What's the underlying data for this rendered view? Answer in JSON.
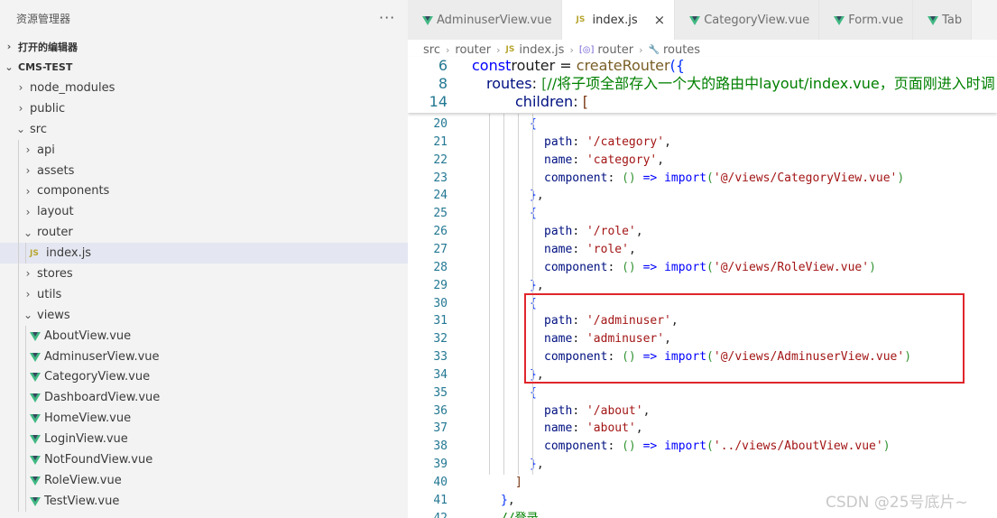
{
  "explorer": {
    "title": "资源管理器",
    "more": "···",
    "open_editors": "打开的编辑器",
    "project": "CMS-TEST",
    "tree": [
      {
        "label": "node_modules",
        "depth": 0,
        "chevron": "›"
      },
      {
        "label": "public",
        "depth": 0,
        "chevron": "›"
      },
      {
        "label": "src",
        "depth": 0,
        "chevron": "⌄"
      },
      {
        "label": "api",
        "depth": 1,
        "chevron": "›"
      },
      {
        "label": "assets",
        "depth": 1,
        "chevron": "›"
      },
      {
        "label": "components",
        "depth": 1,
        "chevron": "›"
      },
      {
        "label": "layout",
        "depth": 1,
        "chevron": "›"
      },
      {
        "label": "router",
        "depth": 1,
        "chevron": "⌄"
      },
      {
        "label": "index.js",
        "depth": 2,
        "icon": "js",
        "selected": true
      },
      {
        "label": "stores",
        "depth": 1,
        "chevron": "›"
      },
      {
        "label": "utils",
        "depth": 1,
        "chevron": "›"
      },
      {
        "label": "views",
        "depth": 1,
        "chevron": "⌄"
      },
      {
        "label": "AboutView.vue",
        "depth": 2,
        "icon": "vue"
      },
      {
        "label": "AdminuserView.vue",
        "depth": 2,
        "icon": "vue"
      },
      {
        "label": "CategoryView.vue",
        "depth": 2,
        "icon": "vue"
      },
      {
        "label": "DashboardView.vue",
        "depth": 2,
        "icon": "vue"
      },
      {
        "label": "HomeView.vue",
        "depth": 2,
        "icon": "vue"
      },
      {
        "label": "LoginView.vue",
        "depth": 2,
        "icon": "vue"
      },
      {
        "label": "NotFoundView.vue",
        "depth": 2,
        "icon": "vue"
      },
      {
        "label": "RoleView.vue",
        "depth": 2,
        "icon": "vue"
      },
      {
        "label": "TestView.vue",
        "depth": 2,
        "icon": "vue"
      }
    ]
  },
  "tabs": [
    {
      "label": "AdminuserView.vue",
      "icon": "vue",
      "active": false
    },
    {
      "label": "index.js",
      "icon": "js",
      "active": true,
      "close": "×"
    },
    {
      "label": "CategoryView.vue",
      "icon": "vue",
      "active": false
    },
    {
      "label": "Form.vue",
      "icon": "vue",
      "active": false
    },
    {
      "label": "Tab",
      "icon": "vue",
      "active": false
    }
  ],
  "breadcrumb": {
    "items": [
      "src",
      "router",
      "index.js",
      "router",
      "routes"
    ],
    "separator": "›"
  },
  "sticky_lines": [
    {
      "n": "6",
      "indent": 0,
      "tokens": [
        [
          "k",
          "const"
        ],
        [
          "",
          "router = "
        ],
        [
          "f",
          "createRouter"
        ],
        [
          "b1",
          "({"
        ]
      ]
    },
    {
      "n": "8",
      "indent": 1,
      "tokens": [
        [
          "p",
          "routes"
        ],
        [
          "",
          ": "
        ],
        [
          "b2",
          "["
        ],
        [
          "c",
          "//将子项全部存入一个大的路由中layout/index.vue，页面刚进入时调"
        ]
      ]
    },
    {
      "n": "14",
      "indent": 3,
      "tokens": [
        [
          "p",
          "children"
        ],
        [
          "",
          ": "
        ],
        [
          "b3",
          "["
        ]
      ]
    }
  ],
  "code_lines": [
    {
      "n": "20",
      "indent": 4,
      "tokens": [
        [
          "b1",
          "{"
        ]
      ]
    },
    {
      "n": "21",
      "indent": 5,
      "tokens": [
        [
          "p",
          "path"
        ],
        [
          "",
          ": "
        ],
        [
          "s",
          "'/category'"
        ],
        [
          "",
          ","
        ]
      ]
    },
    {
      "n": "22",
      "indent": 5,
      "tokens": [
        [
          "p",
          "name"
        ],
        [
          "",
          ": "
        ],
        [
          "s",
          "'category'"
        ],
        [
          "",
          ","
        ]
      ]
    },
    {
      "n": "23",
      "indent": 5,
      "tokens": [
        [
          "p",
          "component"
        ],
        [
          "",
          ": "
        ],
        [
          "b2",
          "()"
        ],
        [
          "k",
          " =>"
        ],
        [
          "",
          ""
        ],
        [
          "k",
          " import"
        ],
        [
          "b2",
          "("
        ],
        [
          "s",
          "'@/views/CategoryView.vue'"
        ],
        [
          "b2",
          ")"
        ]
      ]
    },
    {
      "n": "24",
      "indent": 4,
      "tokens": [
        [
          "b1",
          "}"
        ],
        [
          "",
          ","
        ]
      ]
    },
    {
      "n": "25",
      "indent": 4,
      "tokens": [
        [
          "b1",
          "{"
        ]
      ]
    },
    {
      "n": "26",
      "indent": 5,
      "tokens": [
        [
          "p",
          "path"
        ],
        [
          "",
          ": "
        ],
        [
          "s",
          "'/role'"
        ],
        [
          "",
          ","
        ]
      ]
    },
    {
      "n": "27",
      "indent": 5,
      "tokens": [
        [
          "p",
          "name"
        ],
        [
          "",
          ": "
        ],
        [
          "s",
          "'role'"
        ],
        [
          "",
          ","
        ]
      ]
    },
    {
      "n": "28",
      "indent": 5,
      "tokens": [
        [
          "p",
          "component"
        ],
        [
          "",
          ": "
        ],
        [
          "b2",
          "()"
        ],
        [
          "k",
          " =>"
        ],
        [
          "k",
          " import"
        ],
        [
          "b2",
          "("
        ],
        [
          "s",
          "'@/views/RoleView.vue'"
        ],
        [
          "b2",
          ")"
        ]
      ]
    },
    {
      "n": "29",
      "indent": 4,
      "tokens": [
        [
          "b1",
          "}"
        ],
        [
          "",
          ","
        ]
      ]
    },
    {
      "n": "30",
      "indent": 4,
      "tokens": [
        [
          "b1",
          "{"
        ]
      ]
    },
    {
      "n": "31",
      "indent": 5,
      "tokens": [
        [
          "p",
          "path"
        ],
        [
          "",
          ": "
        ],
        [
          "s",
          "'/adminuser'"
        ],
        [
          "",
          ","
        ]
      ]
    },
    {
      "n": "32",
      "indent": 5,
      "tokens": [
        [
          "p",
          "name"
        ],
        [
          "",
          ": "
        ],
        [
          "s",
          "'adminuser'"
        ],
        [
          "",
          ","
        ]
      ]
    },
    {
      "n": "33",
      "indent": 5,
      "tokens": [
        [
          "p",
          "component"
        ],
        [
          "",
          ": "
        ],
        [
          "b2",
          "()"
        ],
        [
          "k",
          " =>"
        ],
        [
          "k",
          " import"
        ],
        [
          "b2",
          "("
        ],
        [
          "s",
          "'@/views/AdminuserView.vue'"
        ],
        [
          "b2",
          ")"
        ]
      ]
    },
    {
      "n": "34",
      "indent": 4,
      "tokens": [
        [
          "b1",
          "}"
        ],
        [
          "",
          ","
        ]
      ]
    },
    {
      "n": "35",
      "indent": 4,
      "tokens": [
        [
          "b1",
          "{"
        ]
      ]
    },
    {
      "n": "36",
      "indent": 5,
      "tokens": [
        [
          "p",
          "path"
        ],
        [
          "",
          ": "
        ],
        [
          "s",
          "'/about'"
        ],
        [
          "",
          ","
        ]
      ]
    },
    {
      "n": "37",
      "indent": 5,
      "tokens": [
        [
          "p",
          "name"
        ],
        [
          "",
          ": "
        ],
        [
          "s",
          "'about'"
        ],
        [
          "",
          ","
        ]
      ]
    },
    {
      "n": "38",
      "indent": 5,
      "tokens": [
        [
          "p",
          "component"
        ],
        [
          "",
          ": "
        ],
        [
          "b2",
          "()"
        ],
        [
          "k",
          " =>"
        ],
        [
          "k",
          " import"
        ],
        [
          "b2",
          "("
        ],
        [
          "s",
          "'../views/AboutView.vue'"
        ],
        [
          "b2",
          ")"
        ]
      ]
    },
    {
      "n": "39",
      "indent": 4,
      "tokens": [
        [
          "b1",
          "}"
        ],
        [
          "",
          ","
        ]
      ]
    },
    {
      "n": "40",
      "indent": 3,
      "tokens": [
        [
          "b3",
          "]"
        ]
      ]
    },
    {
      "n": "41",
      "indent": 2,
      "tokens": [
        [
          "b1",
          "}"
        ],
        [
          "",
          ","
        ]
      ]
    },
    {
      "n": "42",
      "indent": 2,
      "tokens": [
        [
          "c",
          "//登录"
        ]
      ]
    }
  ],
  "watermark": "CSDN @25号底片~",
  "colors": {
    "keyword": "#0000ff",
    "string": "#a31515",
    "property": "#001080",
    "comment": "#008000",
    "function": "#795e26",
    "line_number": "#237893",
    "highlight_box": "#e0262c",
    "selection": "#e4e6f1"
  }
}
